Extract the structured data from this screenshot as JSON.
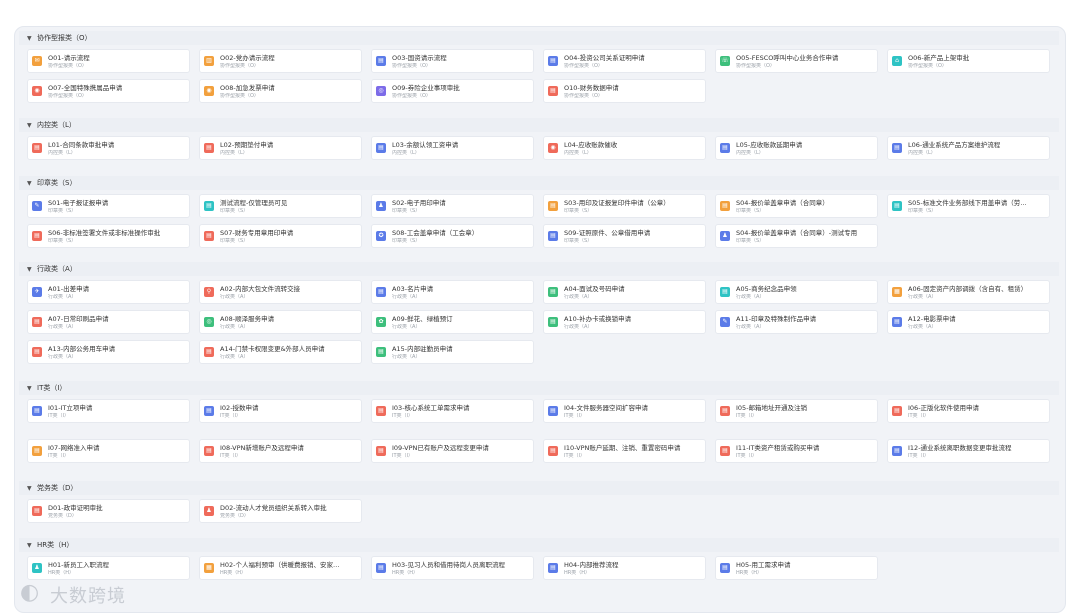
{
  "colors": {
    "blue": "#5b7be8",
    "orange": "#f2a03d",
    "red": "#ef6a5a",
    "green": "#3dbf7c",
    "teal": "#2ec3c4",
    "purple": "#7c6be8"
  },
  "sections": [
    {
      "title": "协作型报类（O）",
      "rows": [
        [
          {
            "t": "O01-请示流程",
            "s": "协作型报类（O）",
            "c": "orange",
            "i": "✉"
          },
          {
            "t": "O02-党办请示流程",
            "s": "协作型报类（O）",
            "c": "orange",
            "i": "▥"
          },
          {
            "t": "O03-国资请示流程",
            "s": "协作型报类（O）",
            "c": "blue",
            "i": "▤"
          },
          {
            "t": "O04-投资公司关系证明申请",
            "s": "协作型报类（O）",
            "c": "blue",
            "i": "▤"
          },
          {
            "t": "O05-FESCO呼叫中心业务合作申请",
            "s": "协作型报类（O）",
            "c": "green",
            "i": "☏"
          },
          {
            "t": "O06-新产品上架审批",
            "s": "协作型报类（O）",
            "c": "teal",
            "i": "⌂"
          }
        ],
        [
          {
            "t": "O07-全国特殊携属品申请",
            "s": "协作型报类（O）",
            "c": "red",
            "i": "◉"
          },
          {
            "t": "O08-加急发票申请",
            "s": "协作型报类（O）",
            "c": "orange",
            "i": "◉"
          },
          {
            "t": "O09-券险企业事项审批",
            "s": "协作型报类（O）",
            "c": "purple",
            "i": "◎"
          },
          {
            "t": "O10-财务数据申请",
            "s": "协作型报类（O）",
            "c": "red",
            "i": "▤"
          }
        ]
      ]
    },
    {
      "title": "内控类（L）",
      "rows": [
        [
          {
            "t": "L01-合同条款审批申请",
            "s": "内控类（L）",
            "c": "red",
            "i": "▤"
          },
          {
            "t": "L02-预期垫付申请",
            "s": "内控类（L）",
            "c": "red",
            "i": "▤"
          },
          {
            "t": "L03-余额认领工资申请",
            "s": "内控类（L）",
            "c": "blue",
            "i": "▤"
          },
          {
            "t": "L04-应收账款催收",
            "s": "内控类（L）",
            "c": "red",
            "i": "◉"
          },
          {
            "t": "L05-应收账款延期申请",
            "s": "内控类（L）",
            "c": "blue",
            "i": "▤"
          },
          {
            "t": "L06-通业系统产品方案维护流程",
            "s": "内控类（L）",
            "c": "blue",
            "i": "▤"
          }
        ]
      ]
    },
    {
      "title": "印章类（S）",
      "rows": [
        [
          {
            "t": "S01-电子报证报申请",
            "s": "印章类（S）",
            "c": "blue",
            "i": "✎"
          },
          {
            "t": "测试流程-仅管理员可见",
            "s": "印章类（S）",
            "c": "teal",
            "i": "▤"
          },
          {
            "t": "S02-电子用印申请",
            "s": "印章类（S）",
            "c": "blue",
            "i": "♟"
          },
          {
            "t": "S03-用印及证报复印件申请（公章）",
            "s": "印章类（S）",
            "c": "orange",
            "i": "▤"
          },
          {
            "t": "S04-报价单盖章申请（合同章）",
            "s": "印章类（S）",
            "c": "orange",
            "i": "▤"
          },
          {
            "t": "S05-标准文件业务部线下用盖申请（劳…",
            "s": "印章类（S）",
            "c": "teal",
            "i": "▤"
          }
        ],
        [
          {
            "t": "S06-非标准签署文件或非标准操作审批",
            "s": "印章类（S）",
            "c": "red",
            "i": "▤"
          },
          {
            "t": "S07-财务专用章用印申请",
            "s": "印章类（S）",
            "c": "red",
            "i": "▤"
          },
          {
            "t": "S08-工会盖章申请（工会章）",
            "s": "印章类（S）",
            "c": "blue",
            "i": "✪"
          },
          {
            "t": "S09-证照原件、公章借用申请",
            "s": "印章类（S）",
            "c": "blue",
            "i": "▤"
          },
          {
            "t": "S04-报价单盖章申请（合同章）-测试专用",
            "s": "印章类（S）",
            "c": "blue",
            "i": "♟"
          }
        ]
      ]
    },
    {
      "title": "行政类（A）",
      "rows": [
        [
          {
            "t": "A01-出差申请",
            "s": "行政类（A）",
            "c": "blue",
            "i": "✈"
          },
          {
            "t": "A02-内部大包文件流转交接",
            "s": "行政类（A）",
            "c": "red",
            "i": "⚲"
          },
          {
            "t": "A03-名片申请",
            "s": "行政类（A）",
            "c": "blue",
            "i": "▤"
          },
          {
            "t": "A04-面试及号码申请",
            "s": "行政类（A）",
            "c": "green",
            "i": "▤"
          },
          {
            "t": "A05-商务纪念品申领",
            "s": "行政类（A）",
            "c": "teal",
            "i": "▤"
          },
          {
            "t": "A06-固定资产内部调拨（含自有、租赁）",
            "s": "行政类（A）",
            "c": "orange",
            "i": "▦"
          }
        ],
        [
          {
            "t": "A07-日常印刷品申请",
            "s": "行政类（A）",
            "c": "red",
            "i": "▤"
          },
          {
            "t": "A08-顺泽服务申请",
            "s": "行政类（A）",
            "c": "green",
            "i": "◎"
          },
          {
            "t": "A09-鲜花、绿植预订",
            "s": "行政类（A）",
            "c": "green",
            "i": "✿"
          },
          {
            "t": "A10-补办卡或换锁申请",
            "s": "行政类（A）",
            "c": "green",
            "i": "▤"
          },
          {
            "t": "A11-印章及特殊制作品申请",
            "s": "行政类（A）",
            "c": "blue",
            "i": "✎"
          },
          {
            "t": "A12-电影票申请",
            "s": "行政类（A）",
            "c": "blue",
            "i": "▤"
          }
        ],
        [
          {
            "t": "A13-内部公务用车申请",
            "s": "行政类（A）",
            "c": "red",
            "i": "▤"
          },
          {
            "t": "A14-门禁卡权限变更&外部人员申请",
            "s": "行政类（A）",
            "c": "red",
            "i": "▤"
          },
          {
            "t": "A15-内部驻勤员申请",
            "s": "行政类（A）",
            "c": "green",
            "i": "▤"
          }
        ]
      ]
    },
    {
      "title": "IT类（I）",
      "rows": [
        [
          {
            "t": "I01-IT立项申请",
            "s": "IT类（I）",
            "c": "blue",
            "i": "▤"
          },
          {
            "t": "I02-授数申请",
            "s": "IT类（I）",
            "c": "blue",
            "i": "▤"
          },
          {
            "t": "I03-核心系统工单需求申请",
            "s": "IT类（I）",
            "c": "red",
            "i": "▤"
          },
          {
            "t": "I04-文件服务器空间扩容申请",
            "s": "IT类（I）",
            "c": "blue",
            "i": "▤"
          },
          {
            "t": "I05-邮箱地址开通及注销",
            "s": "IT类（I）",
            "c": "red",
            "i": "▤"
          },
          {
            "t": "I06-正版化软件使用申请",
            "s": "IT类（I）",
            "c": "red",
            "i": "▤"
          }
        ],
        [
          {
            "t": "I07-网络准入申请",
            "s": "IT类（I）",
            "c": "orange",
            "i": "▤"
          },
          {
            "t": "I08-VPN新增账户及远程申请",
            "s": "IT类（I）",
            "c": "red",
            "i": "▤"
          },
          {
            "t": "I09-VPN已有账户及远程变更申请",
            "s": "IT类（I）",
            "c": "red",
            "i": "▤"
          },
          {
            "t": "I10-VPN账户延期、注销、重置密码申请",
            "s": "IT类（I）",
            "c": "red",
            "i": "▤"
          },
          {
            "t": "I11-IT类资产租赁或购买申请",
            "s": "IT类（I）",
            "c": "red",
            "i": "▤"
          },
          {
            "t": "I12-通业系统离职数据变更审批流程",
            "s": "IT类（I）",
            "c": "blue",
            "i": "▤"
          }
        ]
      ]
    },
    {
      "title": "党务类（D）",
      "rows": [
        [
          {
            "t": "D01-政审证明审批",
            "s": "党务类（D）",
            "c": "red",
            "i": "▤"
          },
          {
            "t": "D02-流动人才党员组织关系转入审批",
            "s": "党务类（D）",
            "c": "red",
            "i": "♟"
          }
        ]
      ]
    },
    {
      "title": "HR类（H）",
      "rows": [
        [
          {
            "t": "H01-新员工入职流程",
            "s": "HR类（H）",
            "c": "teal",
            "i": "♟"
          },
          {
            "t": "H02-个人福利预审（供暖费报销、安家…",
            "s": "HR类（H）",
            "c": "orange",
            "i": "▦"
          },
          {
            "t": "H03-见习人员和借用待岗人员离职流程",
            "s": "HR类（H）",
            "c": "blue",
            "i": "▤"
          },
          {
            "t": "H04-内部推荐流程",
            "s": "HR类（H）",
            "c": "blue",
            "i": "▤"
          },
          {
            "t": "H05-用工需求申请",
            "s": "HR类（H）",
            "c": "blue",
            "i": "▤"
          }
        ]
      ]
    }
  ],
  "logo": {
    "text": "大数跨境"
  }
}
